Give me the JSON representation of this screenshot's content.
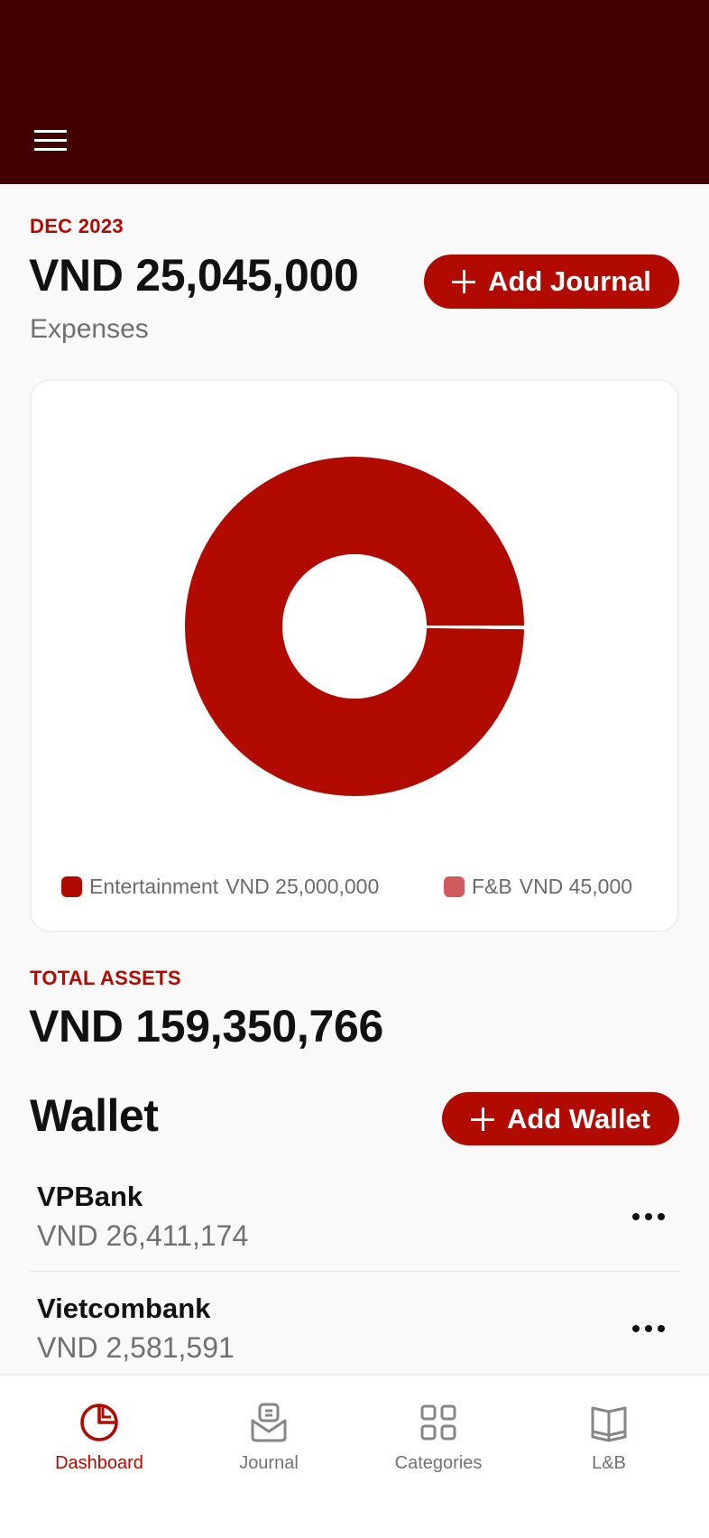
{
  "header": {
    "menu_icon": "hamburger-icon"
  },
  "expenses": {
    "period": "DEC 2023",
    "total": "VND 25,045,000",
    "label": "Expenses",
    "add_button_label": "Add Journal"
  },
  "chart_data": {
    "type": "pie",
    "variant": "donut",
    "title": "",
    "categories": [
      "Entertainment",
      "F&B"
    ],
    "values": [
      25000000,
      45000
    ],
    "currency": "VND",
    "colors": [
      "#b10a00",
      "#d15a5f"
    ],
    "legend": [
      {
        "name": "Entertainment",
        "value_label": "VND 25,000,000"
      },
      {
        "name": "F&B",
        "value_label": "VND 45,000"
      }
    ],
    "legend_position": "bottom"
  },
  "assets": {
    "label": "TOTAL ASSETS",
    "total": "VND 159,350,766"
  },
  "wallet": {
    "title": "Wallet",
    "add_button_label": "Add Wallet",
    "items": [
      {
        "name": "VPBank",
        "balance": "VND 26,411,174"
      },
      {
        "name": "Vietcombank",
        "balance": "VND 2,581,591"
      }
    ]
  },
  "nav": {
    "items": [
      {
        "label": "Dashboard",
        "icon": "pie-chart-icon",
        "active": true
      },
      {
        "label": "Journal",
        "icon": "inbox-document-icon",
        "active": false
      },
      {
        "label": "Categories",
        "icon": "grid-icon",
        "active": false
      },
      {
        "label": "L&B",
        "icon": "open-book-icon",
        "active": false
      }
    ]
  },
  "colors": {
    "header": "#430000",
    "accent": "#b10a00",
    "background": "#f9f9f9",
    "nav_inactive": "#8a8585"
  }
}
